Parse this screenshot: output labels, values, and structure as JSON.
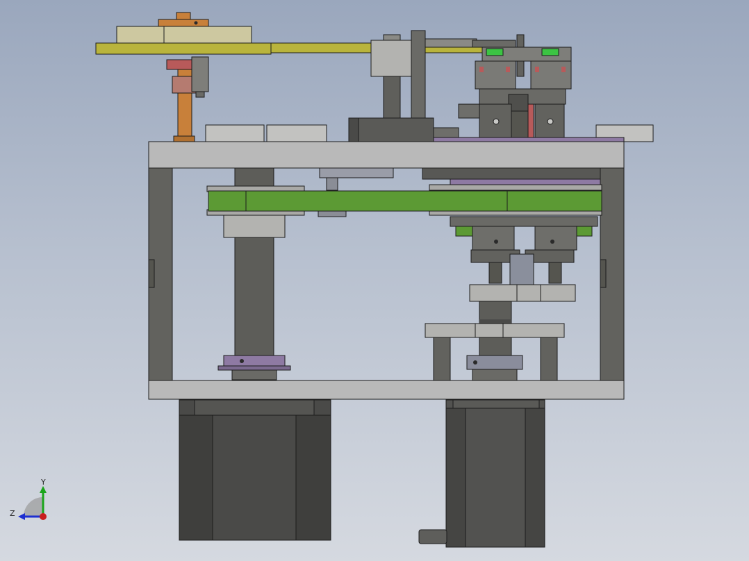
{
  "viewport": {
    "background_top": "#9aa7bd",
    "background_bottom": "#d5d9e0"
  },
  "colors": {
    "frame": "#b9b9b9",
    "frame_dark": "#6a6a66",
    "column": "#5f5f5b",
    "motor": "#4a4a48",
    "belt_green": "#5c9a34",
    "bar_yellow": "#b9b43c",
    "wheel_cream": "#cdc8a0",
    "purple": "#8e7aa3",
    "copper": "#c8803a",
    "red_block": "#b85a5a",
    "accent_green": "#3cc443"
  },
  "triad": {
    "y_label": "Y",
    "z_label": "Z",
    "y_color": "#1aa51a",
    "z_color": "#1d2fd0",
    "origin_color": "#c81e1e"
  },
  "model": {
    "name": "",
    "icons": [
      "coordinate-triad-icon"
    ]
  }
}
